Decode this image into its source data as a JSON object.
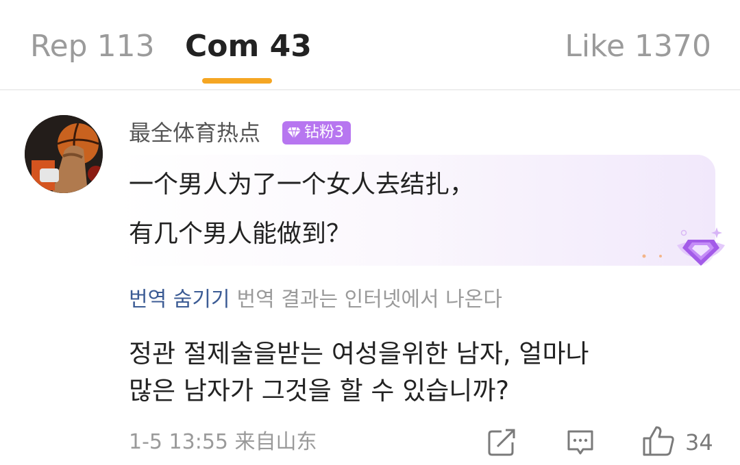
{
  "tabs": {
    "rep": "Rep 113",
    "com": "Com 43",
    "like": "Like 1370",
    "active_color": "#f5a623"
  },
  "comment": {
    "username": "最全体育热点",
    "badge": {
      "text": "钻粉3",
      "color": "#b776f0",
      "icon": "diamond-icon"
    },
    "avatar_icon": "basketball-avatar",
    "text_lines": [
      "一个男人为了一个女人去结扎，",
      "有几个男人能做到？"
    ],
    "translate_toggle": "번역 숨기기",
    "translate_note": "번역 결과는 인터넷에서 나온다",
    "translated_lines": [
      "정관 절제술을받는 여성을위한 남자, 얼마나",
      "많은 남자가 그것을 할 수 있습니까?"
    ],
    "meta": "1-5 13:55 来自山东",
    "actions": {
      "share_icon": "share-icon",
      "reply_icon": "reply-icon",
      "like_icon": "thumbs-up-icon"
    },
    "like_count": "34"
  }
}
